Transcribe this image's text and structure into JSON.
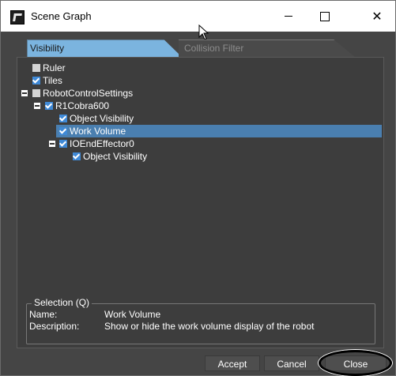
{
  "window": {
    "title": "Scene Graph",
    "minimize_glyph": "—",
    "close_glyph": "✕"
  },
  "tabs": [
    {
      "label": "Visibility",
      "active": true
    },
    {
      "label": "Collision Filter",
      "active": false
    }
  ],
  "tree": [
    {
      "label": "Ruler",
      "checked": false,
      "expander": false,
      "depth": 0
    },
    {
      "label": "Tiles",
      "checked": true,
      "expander": false,
      "depth": 0
    },
    {
      "label": "RobotControlSettings",
      "checked": false,
      "expander": true,
      "depth": 0
    },
    {
      "label": "R1Cobra600",
      "checked": true,
      "expander": true,
      "depth": 1
    },
    {
      "label": "Object Visibility",
      "checked": true,
      "expander": false,
      "depth": 2
    },
    {
      "label": "Work Volume",
      "checked": true,
      "expander": false,
      "depth": 2,
      "selected": true
    },
    {
      "label": "IOEndEffector0",
      "checked": true,
      "expander": true,
      "depth": 2
    },
    {
      "label": "Object Visibility",
      "checked": true,
      "expander": false,
      "depth": 3
    }
  ],
  "selection": {
    "legend": "Selection (Q)",
    "name_label": "Name:",
    "name_value": "Work Volume",
    "description_label": "Description:",
    "description_value": "Show or hide the work volume display of the robot"
  },
  "buttons": {
    "accept": "Accept",
    "cancel": "Cancel",
    "close": "Close"
  },
  "colors": {
    "background": "#454545",
    "tab_active": "#7bb4df",
    "selection_highlight": "#4a7fb0",
    "checkbox_checked": "#3f89d6"
  }
}
